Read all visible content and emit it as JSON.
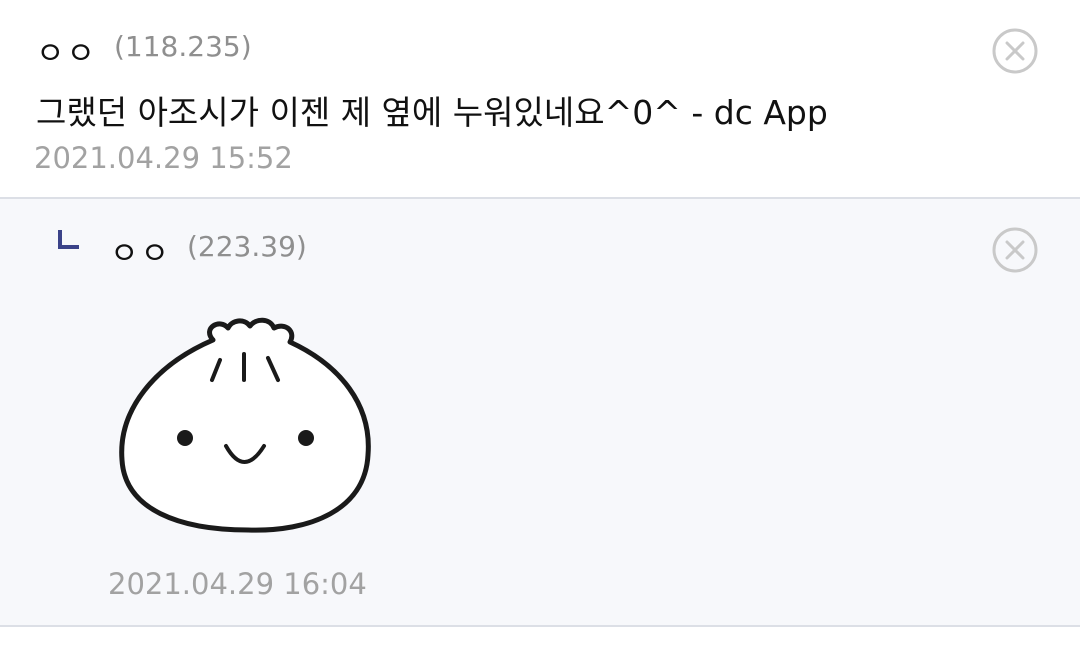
{
  "comments": [
    {
      "nickname": "ㅇㅇ",
      "ip": "(118.235)",
      "text": "그랬던 아조시가 이젠 제 옆에 누워있네요^0^ - dc App",
      "date": "2021.04.29 15:52"
    }
  ],
  "reply": {
    "nickname": "ㅇㅇ",
    "ip": "(223.39)",
    "date": "2021.04.29 16:04",
    "sticker_icon": "dumpling-sticker"
  },
  "colors": {
    "reply_mark": "#3b4389",
    "muted": "#a2a2a2",
    "reply_bg": "#f7f8fb"
  },
  "icons": {
    "delete": "close-circle-icon",
    "reply_indicator": "reply-arrow-icon"
  }
}
